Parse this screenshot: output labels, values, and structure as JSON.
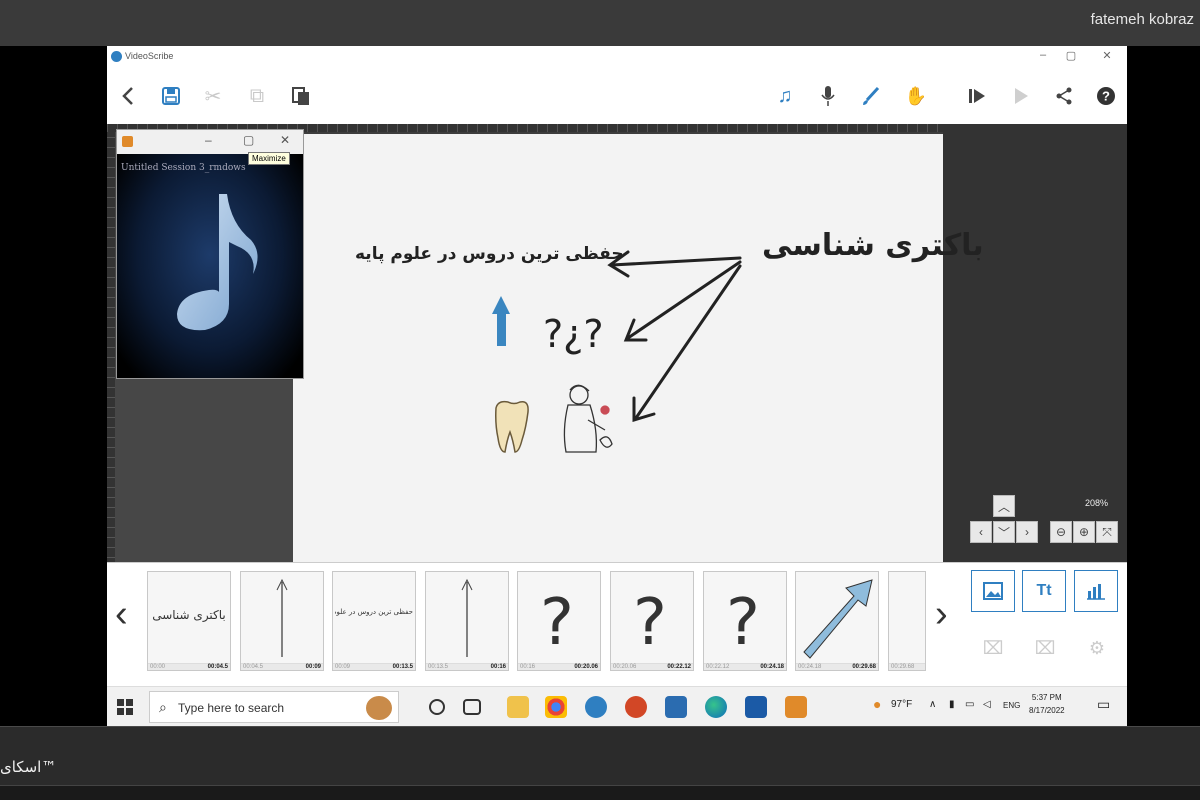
{
  "outer": {
    "user_name": "fatemeh kobraz",
    "bottom_label": "اسکای™"
  },
  "app": {
    "title": "VideoScribe",
    "zoom_level": "208%",
    "accent": "#2f7fc1"
  },
  "toolbar": {
    "left": [
      "back-icon",
      "save-icon",
      "cut-icon",
      "copy-icon",
      "paste-icon"
    ],
    "right": [
      "music-icon",
      "microphone-icon",
      "brush-icon",
      "hand-icon",
      "preview-icon",
      "play-icon",
      "share-icon",
      "help-icon"
    ]
  },
  "player": {
    "session": "Untitled Session 3_rmdows",
    "tooltip": "Maximize"
  },
  "stage": {
    "title": "باکتری شناسی",
    "subtitle": "حفظی ترین دروس در علوم پایه",
    "question_marks": "?¿?"
  },
  "timeline": {
    "items": [
      {
        "label": "باکتری شناسی",
        "start": "00:00",
        "end": "00:04.5"
      },
      {
        "label": "",
        "start": "00:04.5",
        "end": "00:09"
      },
      {
        "label": "حفظی ترین دروس در علوم پایه",
        "start": "00:09",
        "end": "00:13.5"
      },
      {
        "label": "",
        "start": "00:13.5",
        "end": "00:16"
      },
      {
        "label": "",
        "start": "00:16",
        "end": "00:20.06"
      },
      {
        "label": "",
        "start": "00:20.06",
        "end": "00:22.12"
      },
      {
        "label": "",
        "start": "00:22.12",
        "end": "00:24.18"
      },
      {
        "label": "",
        "start": "00:24.18",
        "end": "00:29.68"
      },
      {
        "label": "",
        "start": "00:29.68",
        "end": ""
      }
    ],
    "add_buttons": [
      "image-icon",
      "Tt",
      "chart-icon"
    ]
  },
  "taskbar": {
    "search_placeholder": "Type here to search",
    "weather": "97°F",
    "language": "ENG",
    "time": "5:37 PM",
    "date": "8/17/2022"
  }
}
